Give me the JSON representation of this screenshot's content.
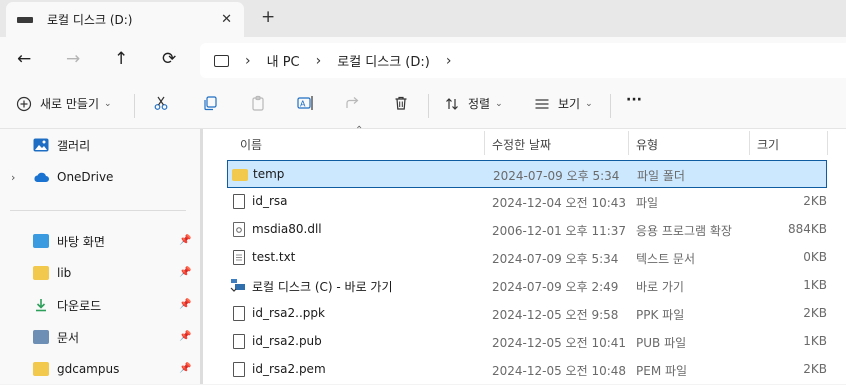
{
  "tab": {
    "title": "로컬 디스크 (D:)",
    "close": "✕",
    "new_tab": "+"
  },
  "nav": {
    "back": "←",
    "forward": "→",
    "up": "↑",
    "refresh": "⟳"
  },
  "breadcrumb": {
    "items": [
      "내 PC",
      "로컬 디스크 (D:)"
    ],
    "chevron": "›"
  },
  "toolbar": {
    "new_label": "새로 만들기",
    "sort_label": "정렬",
    "view_label": "보기",
    "more_label": "···"
  },
  "sidebar": {
    "gallery": "갤러리",
    "onedrive": "OneDrive",
    "quick": [
      {
        "label": "바탕 화면",
        "color": "#3a9be0"
      },
      {
        "label": "lib",
        "color": "#f2c94c"
      },
      {
        "label": "다운로드",
        "color": "#2e9e5b"
      },
      {
        "label": "문서",
        "color": "#6d8fb5"
      },
      {
        "label": "gdcampus",
        "color": "#f2c94c"
      }
    ]
  },
  "columns": {
    "name": "이름",
    "date": "수정한 날짜",
    "type": "유형",
    "size": "크기"
  },
  "files": [
    {
      "name": "temp",
      "date": "2024-07-09 오후 5:34",
      "type": "파일 폴더",
      "size": "",
      "kind": "folder"
    },
    {
      "name": "id_rsa",
      "date": "2024-12-04 오전 10:43",
      "type": "파일",
      "size": "2KB",
      "kind": "file"
    },
    {
      "name": "msdia80.dll",
      "date": "2006-12-01 오후 11:37",
      "type": "응용 프로그램 확장",
      "size": "884KB",
      "kind": "dll"
    },
    {
      "name": "test.txt",
      "date": "2024-07-09 오후 5:34",
      "type": "텍스트 문서",
      "size": "0KB",
      "kind": "txt"
    },
    {
      "name": "로컬 디스크 (C) - 바로 가기",
      "date": "2024-07-09 오후 2:49",
      "type": "바로 가기",
      "size": "1KB",
      "kind": "shortcut"
    },
    {
      "name": "id_rsa2..ppk",
      "date": "2024-12-05 오전 9:58",
      "type": "PPK 파일",
      "size": "2KB",
      "kind": "file"
    },
    {
      "name": "id_rsa2.pub",
      "date": "2024-12-05 오전 10:41",
      "type": "PUB 파일",
      "size": "1KB",
      "kind": "file"
    },
    {
      "name": "id_rsa2.pem",
      "date": "2024-12-05 오전 10:48",
      "type": "PEM 파일",
      "size": "2KB",
      "kind": "file"
    }
  ],
  "colors": {
    "selection_bg": "#cce8ff",
    "selection_border": "#0f5da0",
    "folder": "#f2c94c",
    "accent": "#0067c0"
  }
}
